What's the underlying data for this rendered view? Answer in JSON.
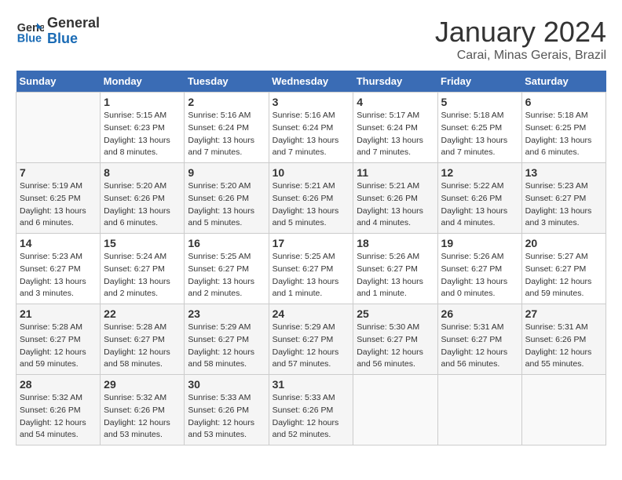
{
  "header": {
    "logo": {
      "line1": "General",
      "line2": "Blue"
    },
    "title": "January 2024",
    "subtitle": "Carai, Minas Gerais, Brazil"
  },
  "calendar": {
    "days_of_week": [
      "Sunday",
      "Monday",
      "Tuesday",
      "Wednesday",
      "Thursday",
      "Friday",
      "Saturday"
    ],
    "weeks": [
      [
        {
          "day": "",
          "info": ""
        },
        {
          "day": "1",
          "info": "Sunrise: 5:15 AM\nSunset: 6:23 PM\nDaylight: 13 hours\nand 8 minutes."
        },
        {
          "day": "2",
          "info": "Sunrise: 5:16 AM\nSunset: 6:24 PM\nDaylight: 13 hours\nand 7 minutes."
        },
        {
          "day": "3",
          "info": "Sunrise: 5:16 AM\nSunset: 6:24 PM\nDaylight: 13 hours\nand 7 minutes."
        },
        {
          "day": "4",
          "info": "Sunrise: 5:17 AM\nSunset: 6:24 PM\nDaylight: 13 hours\nand 7 minutes."
        },
        {
          "day": "5",
          "info": "Sunrise: 5:18 AM\nSunset: 6:25 PM\nDaylight: 13 hours\nand 7 minutes."
        },
        {
          "day": "6",
          "info": "Sunrise: 5:18 AM\nSunset: 6:25 PM\nDaylight: 13 hours\nand 6 minutes."
        }
      ],
      [
        {
          "day": "7",
          "info": "Sunrise: 5:19 AM\nSunset: 6:25 PM\nDaylight: 13 hours\nand 6 minutes."
        },
        {
          "day": "8",
          "info": "Sunrise: 5:20 AM\nSunset: 6:26 PM\nDaylight: 13 hours\nand 6 minutes."
        },
        {
          "day": "9",
          "info": "Sunrise: 5:20 AM\nSunset: 6:26 PM\nDaylight: 13 hours\nand 5 minutes."
        },
        {
          "day": "10",
          "info": "Sunrise: 5:21 AM\nSunset: 6:26 PM\nDaylight: 13 hours\nand 5 minutes."
        },
        {
          "day": "11",
          "info": "Sunrise: 5:21 AM\nSunset: 6:26 PM\nDaylight: 13 hours\nand 4 minutes."
        },
        {
          "day": "12",
          "info": "Sunrise: 5:22 AM\nSunset: 6:26 PM\nDaylight: 13 hours\nand 4 minutes."
        },
        {
          "day": "13",
          "info": "Sunrise: 5:23 AM\nSunset: 6:27 PM\nDaylight: 13 hours\nand 3 minutes."
        }
      ],
      [
        {
          "day": "14",
          "info": "Sunrise: 5:23 AM\nSunset: 6:27 PM\nDaylight: 13 hours\nand 3 minutes."
        },
        {
          "day": "15",
          "info": "Sunrise: 5:24 AM\nSunset: 6:27 PM\nDaylight: 13 hours\nand 2 minutes."
        },
        {
          "day": "16",
          "info": "Sunrise: 5:25 AM\nSunset: 6:27 PM\nDaylight: 13 hours\nand 2 minutes."
        },
        {
          "day": "17",
          "info": "Sunrise: 5:25 AM\nSunset: 6:27 PM\nDaylight: 13 hours\nand 1 minute."
        },
        {
          "day": "18",
          "info": "Sunrise: 5:26 AM\nSunset: 6:27 PM\nDaylight: 13 hours\nand 1 minute."
        },
        {
          "day": "19",
          "info": "Sunrise: 5:26 AM\nSunset: 6:27 PM\nDaylight: 13 hours\nand 0 minutes."
        },
        {
          "day": "20",
          "info": "Sunrise: 5:27 AM\nSunset: 6:27 PM\nDaylight: 12 hours\nand 59 minutes."
        }
      ],
      [
        {
          "day": "21",
          "info": "Sunrise: 5:28 AM\nSunset: 6:27 PM\nDaylight: 12 hours\nand 59 minutes."
        },
        {
          "day": "22",
          "info": "Sunrise: 5:28 AM\nSunset: 6:27 PM\nDaylight: 12 hours\nand 58 minutes."
        },
        {
          "day": "23",
          "info": "Sunrise: 5:29 AM\nSunset: 6:27 PM\nDaylight: 12 hours\nand 58 minutes."
        },
        {
          "day": "24",
          "info": "Sunrise: 5:29 AM\nSunset: 6:27 PM\nDaylight: 12 hours\nand 57 minutes."
        },
        {
          "day": "25",
          "info": "Sunrise: 5:30 AM\nSunset: 6:27 PM\nDaylight: 12 hours\nand 56 minutes."
        },
        {
          "day": "26",
          "info": "Sunrise: 5:31 AM\nSunset: 6:27 PM\nDaylight: 12 hours\nand 56 minutes."
        },
        {
          "day": "27",
          "info": "Sunrise: 5:31 AM\nSunset: 6:26 PM\nDaylight: 12 hours\nand 55 minutes."
        }
      ],
      [
        {
          "day": "28",
          "info": "Sunrise: 5:32 AM\nSunset: 6:26 PM\nDaylight: 12 hours\nand 54 minutes."
        },
        {
          "day": "29",
          "info": "Sunrise: 5:32 AM\nSunset: 6:26 PM\nDaylight: 12 hours\nand 53 minutes."
        },
        {
          "day": "30",
          "info": "Sunrise: 5:33 AM\nSunset: 6:26 PM\nDaylight: 12 hours\nand 53 minutes."
        },
        {
          "day": "31",
          "info": "Sunrise: 5:33 AM\nSunset: 6:26 PM\nDaylight: 12 hours\nand 52 minutes."
        },
        {
          "day": "",
          "info": ""
        },
        {
          "day": "",
          "info": ""
        },
        {
          "day": "",
          "info": ""
        }
      ]
    ]
  }
}
